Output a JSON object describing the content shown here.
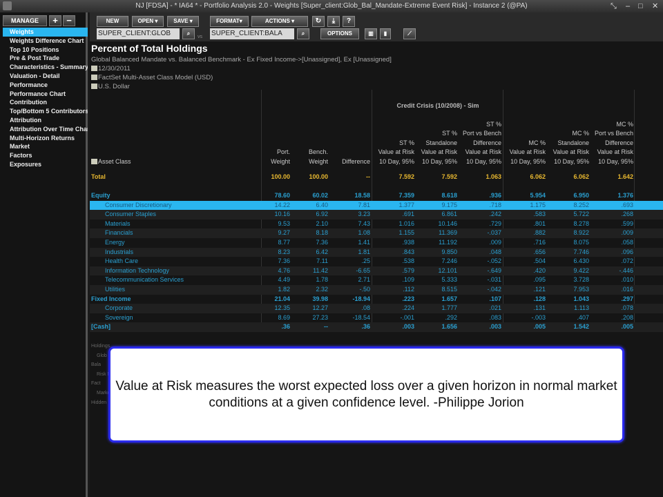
{
  "window": {
    "title": "NJ [FDSA] - * IA64 * - Portfolio Analysis 2.0 - Weights [Super_client:Glob_Bal_Mandate-Extreme Event Risk] - Instance 2 (@PA)"
  },
  "sidebar": {
    "manage": "MANAGE",
    "plus": "+",
    "minus": "−",
    "items": [
      "Weights",
      "Weights Difference Chart",
      "Top 10 Positions",
      "Pre & Post Trade",
      "Characteristics - Summary",
      "Valuation - Detail",
      "Performance",
      "Performance Chart",
      "Contribution",
      "Top/Bottom 5 Contributors",
      "Attribution",
      "Attribution Over Time Chart",
      "Multi-Horizon Returns",
      "Market",
      "Factors",
      "Exposures"
    ]
  },
  "toolbar": {
    "new": "NEW",
    "open": "OPEN ▾",
    "save": "SAVE ▾",
    "format": "FORMAT▾",
    "actions": "ACTIONS ▾",
    "refresh": "↻",
    "download": "⤓",
    "help": "?",
    "portfolio": "SUPER_CLIENT:GLOB",
    "vs": "vs",
    "benchmark": "SUPER_CLIENT:BALA",
    "options": "OPTIONS"
  },
  "report": {
    "title": "Percent of Total Holdings",
    "subtitle": "Global Balanced Mandate vs. Balanced Benchmark - Ex Fixed Income->[Unassigned], Ex [Unassigned]",
    "date": "12/30/2011",
    "model": "FactSet Multi-Asset Class Model (USD)",
    "currency": "U.S. Dollar"
  },
  "table": {
    "group_header": "Credit Crisis (10/2008) - Sim",
    "headers": [
      "Asset Class",
      "Port.\nWeight",
      "Bench.\nWeight",
      "Difference",
      "ST %\nValue at Risk\n10 Day, 95%",
      "ST %\nStandalone\nValue at Risk\n10 Day, 95%",
      "ST %\nPort vs Bench\nDifference\nValue at Risk\n10 Day, 95%",
      "MC %\nValue at Risk\n10 Day, 95%",
      "MC %\nStandalone\nValue at Risk\n10 Day, 95%",
      "MC %\nPort vs Bench\nDifference\nValue at Risk\n10 Day, 95%"
    ],
    "rows": [
      {
        "type": "total",
        "cells": [
          "Total",
          "100.00",
          "100.00",
          "--",
          "7.592",
          "7.592",
          "1.063",
          "6.062",
          "6.062",
          "1.642"
        ]
      },
      {
        "type": "group",
        "cells": [
          "Equity",
          "78.60",
          "60.02",
          "18.58",
          "7.359",
          "8.618",
          ".936",
          "5.954",
          "6.950",
          "1.376"
        ]
      },
      {
        "type": "hl",
        "cells": [
          "Consumer Discretionary",
          "14.22",
          "6.40",
          "7.81",
          "1.377",
          "9.175",
          ".718",
          "1.175",
          "8.252",
          ".693"
        ]
      },
      {
        "type": "child",
        "cells": [
          "Consumer Staples",
          "10.16",
          "6.92",
          "3.23",
          ".691",
          "6.861",
          ".242",
          ".583",
          "5.722",
          ".268"
        ]
      },
      {
        "type": "child",
        "cells": [
          "Materials",
          "9.53",
          "2.10",
          "7.43",
          "1.016",
          "10.146",
          ".729",
          ".801",
          "8.278",
          ".599"
        ]
      },
      {
        "type": "child",
        "cells": [
          "Financials",
          "9.27",
          "8.18",
          "1.08",
          "1.155",
          "11.369",
          "-.037",
          ".882",
          "8.922",
          ".009"
        ]
      },
      {
        "type": "child",
        "cells": [
          "Energy",
          "8.77",
          "7.36",
          "1.41",
          ".938",
          "11.192",
          ".009",
          ".716",
          "8.075",
          ".058"
        ]
      },
      {
        "type": "child",
        "cells": [
          "Industrials",
          "8.23",
          "6.42",
          "1.81",
          ".843",
          "9.850",
          ".048",
          ".656",
          "7.746",
          ".096"
        ]
      },
      {
        "type": "child",
        "cells": [
          "Health Care",
          "7.36",
          "7.11",
          ".25",
          ".538",
          "7.246",
          "-.052",
          ".504",
          "6.430",
          ".072"
        ]
      },
      {
        "type": "child",
        "cells": [
          "Information Technology",
          "4.76",
          "11.42",
          "-6.65",
          ".579",
          "12.101",
          "-.649",
          ".420",
          "9.422",
          "-.446"
        ]
      },
      {
        "type": "child",
        "cells": [
          "Telecommunication Services",
          "4.49",
          "1.78",
          "2.71",
          ".109",
          "5.333",
          "-.031",
          ".095",
          "3.728",
          ".010"
        ]
      },
      {
        "type": "child",
        "cells": [
          "Utilities",
          "1.82",
          "2.32",
          "-.50",
          ".112",
          "8.515",
          "-.042",
          ".121",
          "7.953",
          ".016"
        ]
      },
      {
        "type": "group",
        "cells": [
          "Fixed Income",
          "21.04",
          "39.98",
          "-18.94",
          ".223",
          "1.657",
          ".107",
          ".128",
          "1.043",
          ".297"
        ]
      },
      {
        "type": "child",
        "cells": [
          "Corporate",
          "12.35",
          "12.27",
          ".08",
          ".224",
          "1.777",
          ".021",
          ".131",
          "1.113",
          ".078"
        ]
      },
      {
        "type": "child",
        "cells": [
          "Sovereign",
          "8.69",
          "27.23",
          "-18.54",
          "-.001",
          ".292",
          ".083",
          "-.003",
          ".407",
          ".208"
        ]
      },
      {
        "type": "group",
        "cells": [
          "[Cash]",
          ".36",
          "--",
          ".36",
          ".003",
          "1.656",
          ".003",
          ".005",
          "1.542",
          ".005"
        ]
      }
    ]
  },
  "footnotes": [
    "Holdings...",
    "Glob",
    "Bala",
    "Risk M",
    "Fact",
    "Market",
    "Hidden"
  ],
  "overlay": {
    "text": "Value at Risk measures the worst expected loss over a given horizon in normal market conditions at a given confidence level. -Philippe Jorion"
  }
}
